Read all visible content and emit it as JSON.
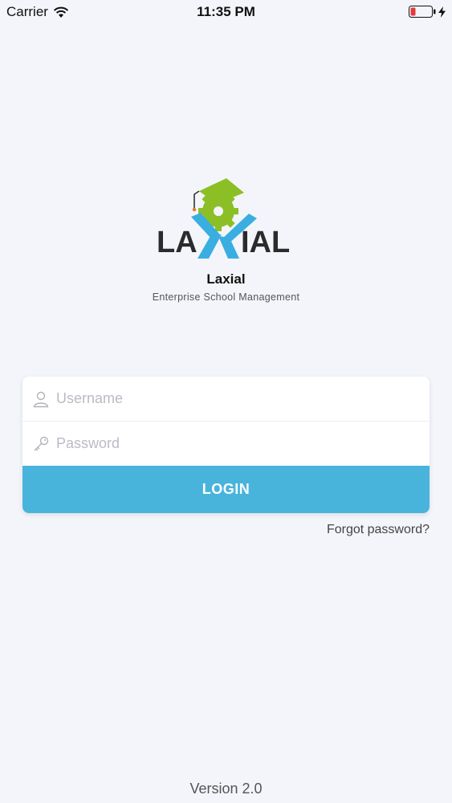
{
  "status_bar": {
    "carrier": "Carrier",
    "time": "11:35 PM",
    "wifi_icon": "wifi-icon",
    "battery_icon": "battery-low-icon",
    "charging_icon": "bolt-icon"
  },
  "brand": {
    "logo_icon": "laxial-logo",
    "logo_text_left": "LA",
    "logo_text_right": "IAL",
    "name": "Laxial",
    "tagline": "Enterprise School Management",
    "colors": {
      "green": "#8cbf26",
      "blue": "#3aaee0",
      "dark": "#2b2b2b"
    }
  },
  "login": {
    "username_placeholder": "Username",
    "username_value": "",
    "password_placeholder": "Password",
    "password_value": "",
    "button_label": "LOGIN",
    "forgot_label": "Forgot password?",
    "accent_color": "#48b4dc"
  },
  "footer": {
    "version": "Version 2.0"
  }
}
